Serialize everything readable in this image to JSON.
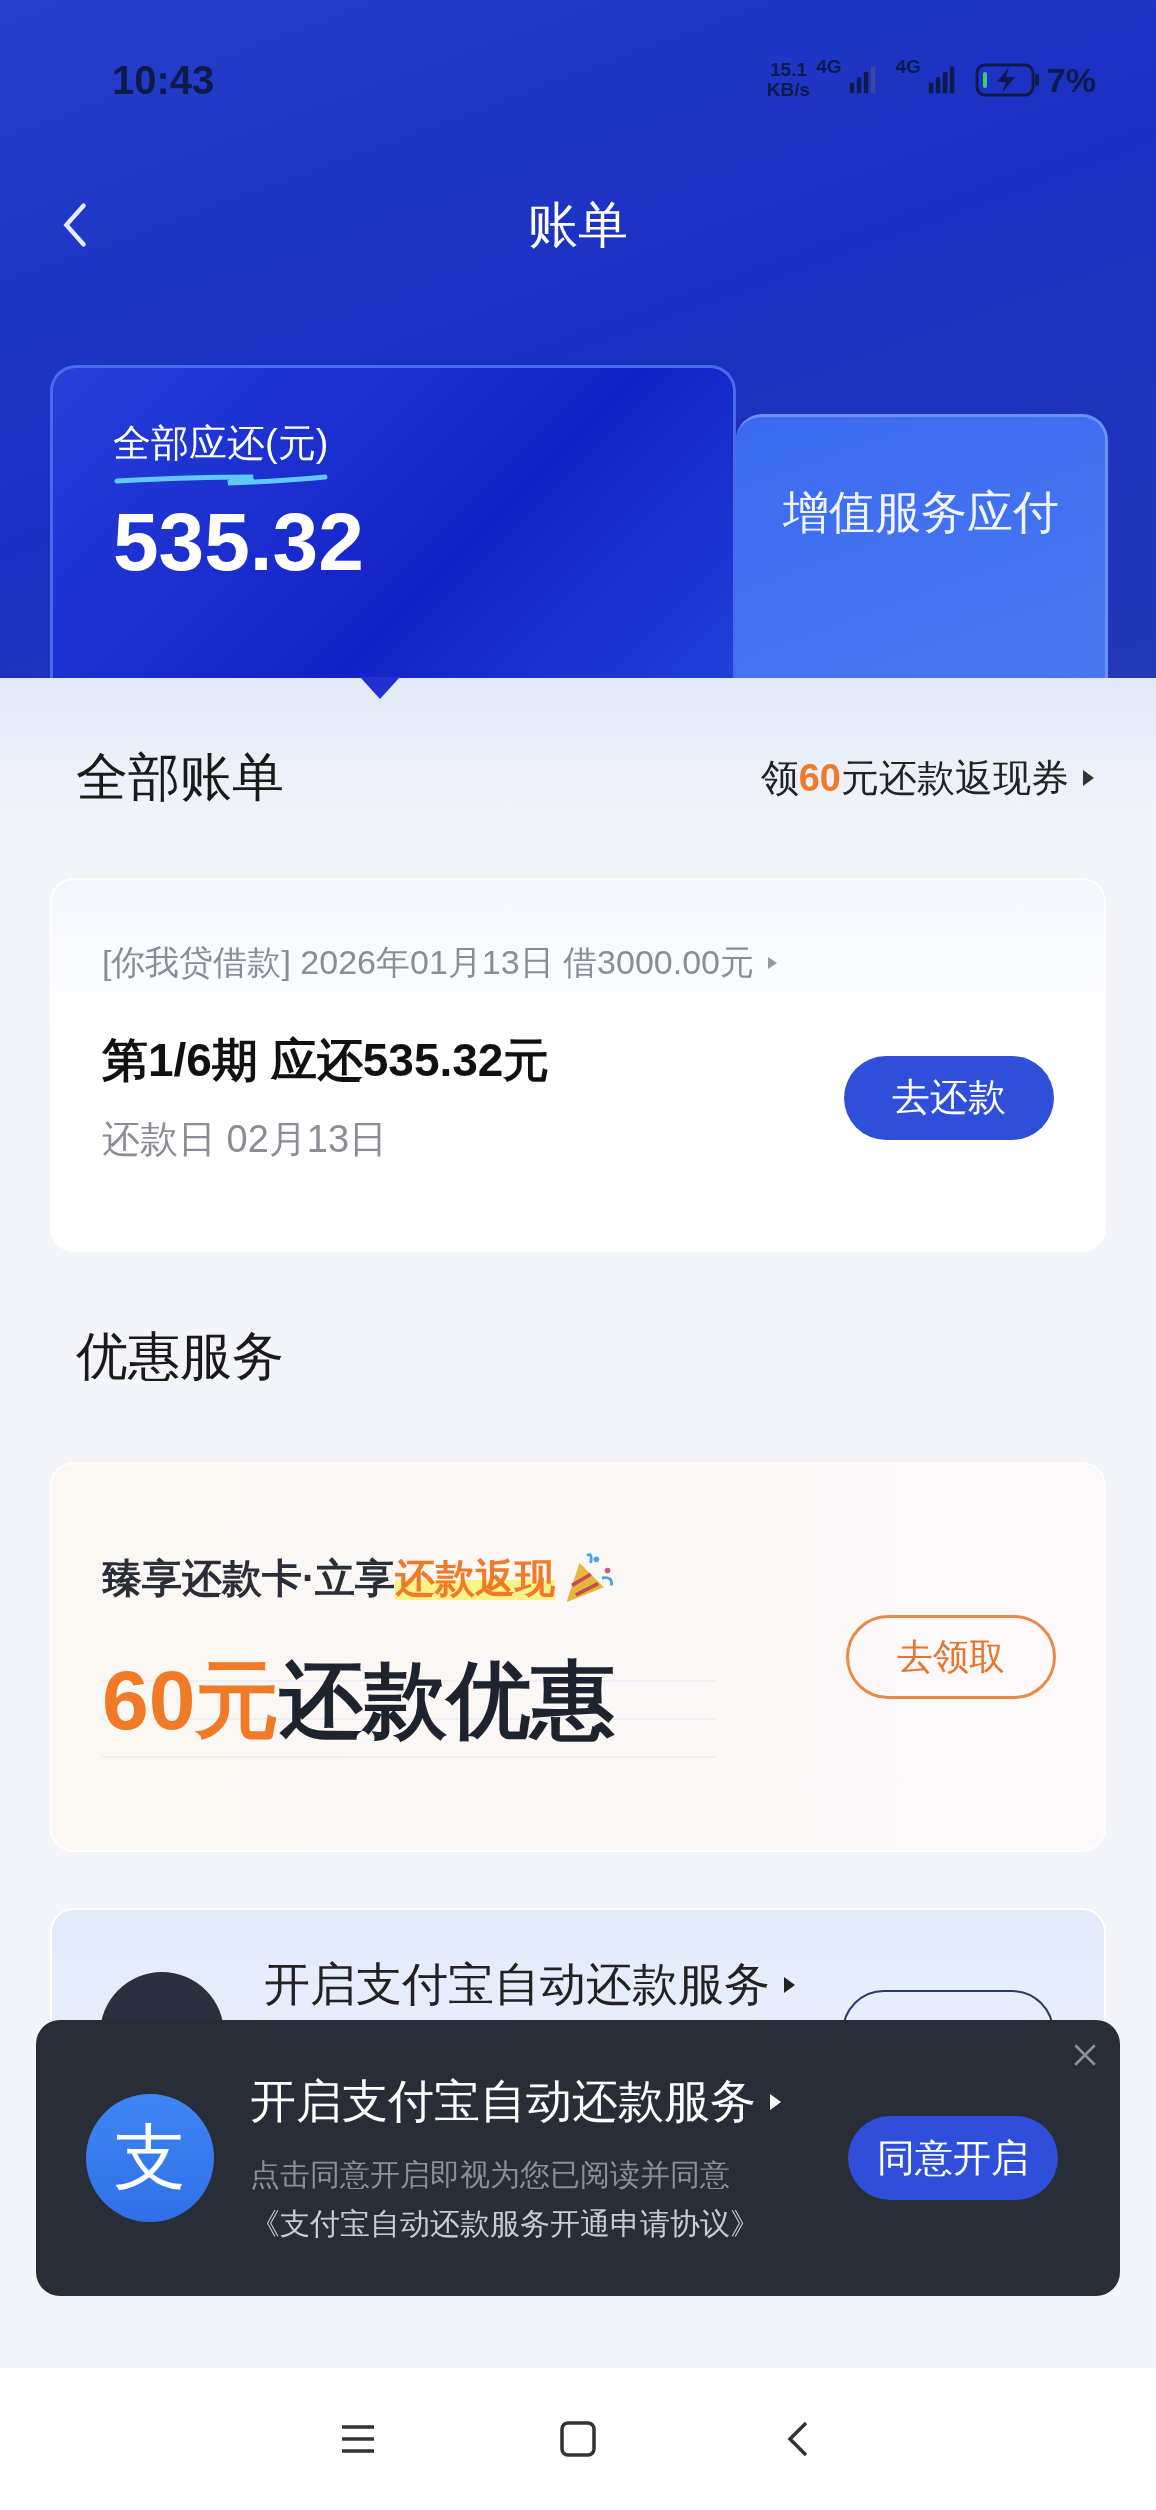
{
  "status_bar": {
    "time": "10:43",
    "net_speed": [
      "15.1",
      "KB/s"
    ],
    "networks": [
      "4G",
      "4G"
    ],
    "battery_percent": "7%"
  },
  "header": {
    "title": "账单"
  },
  "summary_tabs": [
    {
      "label": "全部应还(元)",
      "value": "535.32",
      "selected": true
    },
    {
      "label": "增值服务应付",
      "selected": false
    }
  ],
  "bills": {
    "title": "全部账单",
    "promo_link": {
      "prefix": "领",
      "highlight": "60",
      "suffix": "元还款返现券"
    },
    "card": {
      "loan": "[你我贷借款] 2026年01月13日 借3000.00元",
      "installment": "第1/6期 应还535.32元",
      "due": "还款日 02月13日",
      "button": "去还款"
    }
  },
  "offers": {
    "title": "优惠服务",
    "card": {
      "tagline": "臻享还款卡·立享",
      "tagline_highlight": "还款返现",
      "amount": "60元",
      "headline": "还款优惠",
      "button": "去领取"
    }
  },
  "autopay_card": {
    "title": "开启支付宝自动还款服务"
  },
  "toast": {
    "logo": "支",
    "title": "开启支付宝自动还款服务",
    "note": "点击同意开启即视为您已阅读并同意",
    "agreement": "《支付宝自动还款服务开通申请协议》",
    "button": "同意开启"
  }
}
